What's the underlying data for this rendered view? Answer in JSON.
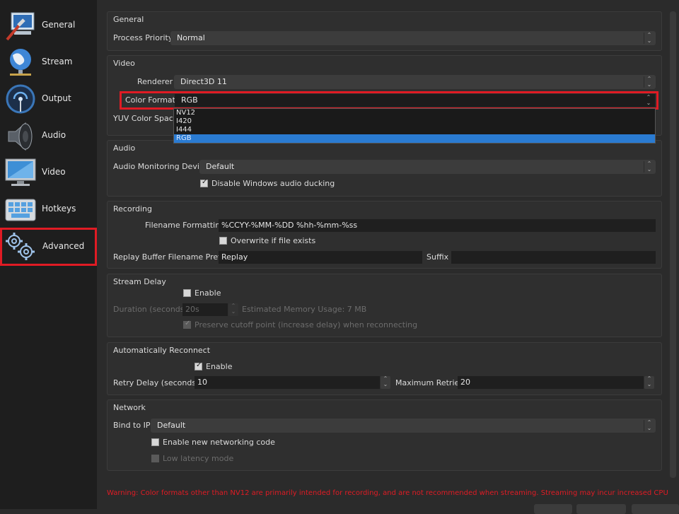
{
  "sidebar": {
    "items": [
      {
        "label": "General",
        "icon": "general-icon"
      },
      {
        "label": "Stream",
        "icon": "stream-globe-icon"
      },
      {
        "label": "Output",
        "icon": "output-signal-icon"
      },
      {
        "label": "Audio",
        "icon": "speaker-icon"
      },
      {
        "label": "Video",
        "icon": "monitor-icon"
      },
      {
        "label": "Hotkeys",
        "icon": "keyboard-icon"
      },
      {
        "label": "Advanced",
        "icon": "gears-icon",
        "selected": true
      }
    ]
  },
  "general": {
    "title": "General",
    "process_priority_label": "Process Priority",
    "process_priority_value": "Normal"
  },
  "video": {
    "title": "Video",
    "renderer_label": "Renderer",
    "renderer_value": "Direct3D 11",
    "color_format_label": "Color Format",
    "color_format_value": "RGB",
    "color_format_options": [
      "NV12",
      "I420",
      "I444",
      "RGB"
    ],
    "yuv_color_space_label": "YUV Color Space"
  },
  "audio": {
    "title": "Audio",
    "monitoring_device_label": "Audio Monitoring Device",
    "monitoring_device_value": "Default",
    "disable_ducking_label": "Disable Windows audio ducking",
    "disable_ducking_checked": true
  },
  "recording": {
    "title": "Recording",
    "filename_formatting_label": "Filename Formatting",
    "filename_formatting_value": "%CCYY-%MM-%DD %hh-%mm-%ss",
    "overwrite_label": "Overwrite if file exists",
    "overwrite_checked": false,
    "replay_prefix_label": "Replay Buffer Filename Prefix",
    "replay_prefix_value": "Replay",
    "suffix_label": "Suffix",
    "suffix_value": ""
  },
  "stream_delay": {
    "title": "Stream Delay",
    "enable_label": "Enable",
    "enable_checked": false,
    "duration_label": "Duration (seconds)",
    "duration_value": "20s",
    "memory_usage_label": "Estimated Memory Usage: 7 MB",
    "preserve_label": "Preserve cutoff point (increase delay) when reconnecting",
    "preserve_checked": true
  },
  "reconnect": {
    "title": "Automatically Reconnect",
    "enable_label": "Enable",
    "enable_checked": true,
    "retry_delay_label": "Retry Delay (seconds)",
    "retry_delay_value": "10",
    "max_retries_label": "Maximum Retries",
    "max_retries_value": "20"
  },
  "network": {
    "title": "Network",
    "bind_ip_label": "Bind to IP",
    "bind_ip_value": "Default",
    "new_networking_label": "Enable new networking code",
    "new_networking_checked": false,
    "low_latency_label": "Low latency mode",
    "low_latency_checked": false
  },
  "warning": "Warning: Color formats other than NV12 are primarily intended for recording, and are not recommended when streaming. Streaming may incur increased CPU",
  "colors": {
    "highlight_red": "#e01b24",
    "selection_blue": "#2a7bd2",
    "background": "#2b2b2b",
    "sidebar": "#1e1e1e"
  }
}
